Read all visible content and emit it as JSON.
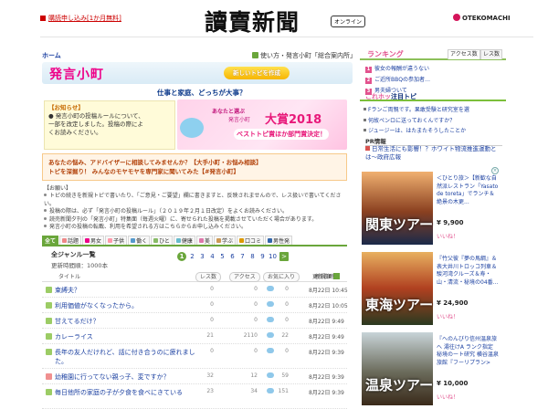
{
  "header": {
    "subscribe_link": "購読申し込み[1か月無料]",
    "logo": "讀賣新聞",
    "online_badge": "オンライン",
    "brand": "OTEKOMACHI"
  },
  "nav": {
    "home": "ホーム",
    "howto": "使い方・発言小町「総合案内所」",
    "hatsugen_logo_a": "発言",
    "hatsugen_logo_b": "小町",
    "new_topic": "新しいトピを作成",
    "tagline": "仕事と家庭、どっちが大事？"
  },
  "notice": {
    "heading": "【お知らせ】",
    "line1": "● 発言小町の投稿ルールについて、",
    "line2": "一部を改定しました。投稿の際によ",
    "line3": "くお読みください。"
  },
  "banner": {
    "line1": "あなたと選ぶ",
    "line2": "発言小町",
    "line3": "大賞2018",
    "line4": "ベストトピ賞ほか部門賞決定！"
  },
  "consult": {
    "line1": "あなたの悩み、アドバイザーに相談してみませんか？【大手小町・お悩み相談】",
    "line2": "トピを深掘り！ みんなのモヤモヤを専門家に聞いてみた【#発言小町】"
  },
  "requests": {
    "heading": "【お願い】",
    "items": [
      "トピの続きを新規トピで書いたり、「ご意見・ご要望」欄に書きますと、反映されませんので、レス扱いで書いてください。",
      "投稿の際は、必ず「発言小町の投稿ルール」（２０１９年２月１日改定）をよくお読みください。",
      "読売新聞夕刊の「発言小町」特集面（毎週火曜）に、寄せられた投稿を掲載させていただく場合があります。",
      "発言小町の投稿の転載、利用を希望される方はこちらからお申し込みください。"
    ]
  },
  "categories": [
    {
      "label": "全て",
      "color": "#6aa63b",
      "active": true
    },
    {
      "label": "話題",
      "color": "#e88"
    },
    {
      "label": "男女",
      "color": "#e08"
    },
    {
      "label": "子供",
      "color": "#f9a"
    },
    {
      "label": "働く",
      "color": "#59c"
    },
    {
      "label": "ひと",
      "color": "#8b6"
    },
    {
      "label": "健康",
      "color": "#6bc"
    },
    {
      "label": "美",
      "color": "#d7a"
    },
    {
      "label": "学ぶ",
      "color": "#c95"
    },
    {
      "label": "口コミ",
      "color": "#d90"
    },
    {
      "label": "男性発",
      "color": "#36a"
    }
  ],
  "list": {
    "title": "全ジャンル一覧",
    "updated": "更新時間順：1000本",
    "pages": [
      "1",
      "2",
      "3",
      "4",
      "5",
      "6",
      "7",
      "8",
      "9",
      "10"
    ],
    "next": ">",
    "rss": "新規順",
    "col_title": "タイトル",
    "col_res": "レス数",
    "col_access": "アクセス",
    "col_fav": "お気に入り",
    "col_updated": "更新日時",
    "rows": [
      {
        "title": "束縛夫？",
        "res": "0",
        "access": "0",
        "fav": "0",
        "date": "8月22日 10:45",
        "pink": false,
        "tall": false
      },
      {
        "title": "利用価値がなくなったから。",
        "res": "0",
        "access": "0",
        "fav": "0",
        "date": "8月22日 10:05",
        "pink": false,
        "tall": false
      },
      {
        "title": "甘えてるだけ？",
        "res": "0",
        "access": "0",
        "fav": "0",
        "date": "8月22日 9:49",
        "pink": false,
        "tall": false
      },
      {
        "title": "カレーライス",
        "res": "21",
        "access": "2110",
        "fav": "22",
        "date": "8月22日 9:49",
        "pink": false,
        "tall": false
      },
      {
        "title": "長年の友人だけれど、話に付き合うのに疲れました。",
        "res": "0",
        "access": "0",
        "fav": "0",
        "date": "8月22日 9:39",
        "pink": false,
        "tall": true
      },
      {
        "title": "幼稚園に行ってない親っ子、変ですか？",
        "res": "32",
        "access": "12",
        "fav": "59",
        "date": "8月22日 9:39",
        "pink": true,
        "tall": false
      },
      {
        "title": "毎日他所の家庭の子が夕食を食べにきている",
        "res": "23",
        "access": "34",
        "fav": "151",
        "date": "8月22日 9:39",
        "pink": false,
        "tall": true
      }
    ]
  },
  "ranking": {
    "title": "ランキング",
    "tab1": "アクセス数",
    "tab2": "レス数",
    "items": [
      "彼女の報酬が違うない",
      "ご近所BBQの参加者…",
      "男夫婦ついて"
    ]
  },
  "news": {
    "title_a": "これ",
    "title_b": "ホッ",
    "title_c": "注目トピ",
    "items": [
      "Fランご両親です。果敢受験と研究室を選",
      "何故ペンロに送っておくんですか？",
      "ジュージーは、はたまたそうしたことか"
    ]
  },
  "pr": {
    "heading": "PR情報",
    "text": "日常生活にも影響！？ホワイト物流推進運動とは〜政府広報"
  },
  "ads": [
    {
      "label": "関東ツアー",
      "text": "＜ひとり旅＞【新歓な自然派レストラン「Yasato de toreta」でランチ＆絶景の木更...",
      "price": "¥ 9,900",
      "like": "いいね！"
    },
    {
      "label": "東海ツアー",
      "text": "『竹父彼『夢の馬綱』＆表大井川トロッコ列車＆駿河湾クルーズ＆寿・山・清流・秘境の04番...",
      "price": "¥ 24,900",
      "like": "いいね！"
    },
    {
      "label": "温泉ツアー",
      "text": "『へのんびり信州温泉旅へ 湯往けA ランク指定 秘境のート研究 横谷温泉旅館『フーリプラン>",
      "price": "¥ 10,000",
      "like": "いいね！"
    }
  ],
  "ad_close": "×"
}
